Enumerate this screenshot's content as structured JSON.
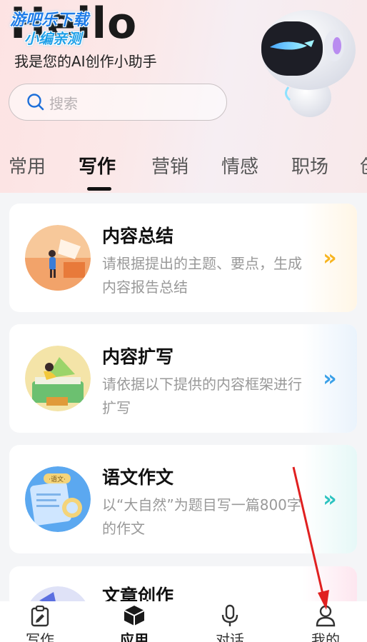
{
  "header": {
    "hello_text": "Hello",
    "watermark_line1": "游吧乐下载",
    "watermark_line2": "小编亲测",
    "subtitle": "我是您的AI创作小助手"
  },
  "search": {
    "placeholder": "搜索",
    "icon": "search-icon"
  },
  "tabs": [
    {
      "label": "常用",
      "active": false
    },
    {
      "label": "写作",
      "active": true
    },
    {
      "label": "营销",
      "active": false
    },
    {
      "label": "情感",
      "active": false
    },
    {
      "label": "职场",
      "active": false
    },
    {
      "label": "创",
      "active": false
    }
  ],
  "cards": [
    {
      "title": "内容总结",
      "desc": "请根据提出的主题、要点，生成内容报告总结",
      "icon": "double-chevron-right-icon",
      "accent": "#f7b520"
    },
    {
      "title": "内容扩写",
      "desc": "请依据以下提供的内容框架进行扩写",
      "icon": "double-chevron-right-icon",
      "accent": "#3aa0e8"
    },
    {
      "title": "语文作文",
      "desc": "以“大自然”为题目写一篇800字的作文",
      "icon": "double-chevron-right-icon",
      "accent": "#2cc3c0"
    },
    {
      "title": "文章创作",
      "desc": "",
      "icon": "double-chevron-right-icon",
      "accent": "#e879a8"
    }
  ],
  "bottom_nav": [
    {
      "label": "写作",
      "icon": "edit-clipboard-icon",
      "active": false
    },
    {
      "label": "应用",
      "icon": "cube-icon",
      "active": true
    },
    {
      "label": "对话",
      "icon": "microphone-icon",
      "active": false
    },
    {
      "label": "我的",
      "icon": "user-icon",
      "active": false
    }
  ],
  "colors": {
    "accent_red_arrow": "#e02020"
  }
}
